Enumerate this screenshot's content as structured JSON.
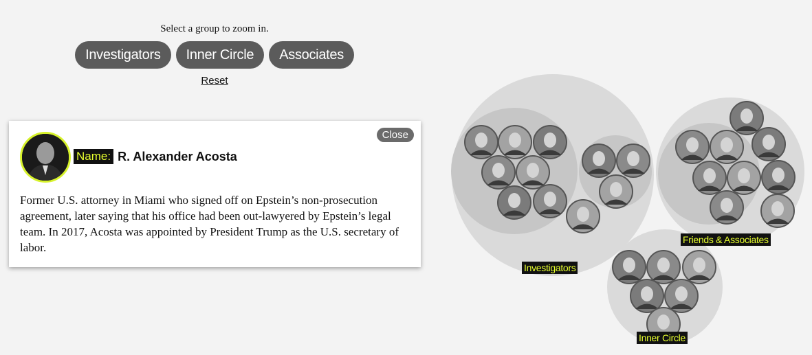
{
  "header": {
    "prompt": "Select a group to zoom in.",
    "buttons": [
      "Investigators",
      "Inner Circle",
      "Associates"
    ],
    "reset_label": "Reset"
  },
  "detail_card": {
    "close_label": "Close",
    "name_label": "Name:",
    "name_value": "R. Alexander Acosta",
    "description": "Former U.S. attorney in Miami who signed off on Epstein’s non-prosecution agreement, later saying that his office had been out-lawyered by Epstein’s legal team. In 2017, Acosta was appointed by President Trump as the U.S. secretary of labor."
  },
  "groups": {
    "investigators": "Investigators",
    "friends": "Friends & Associates",
    "inner": "Inner Circle"
  },
  "colors": {
    "highlight": "#e7ff2e",
    "button_bg": "#5b5b5b",
    "bubble_outer": "#d9d9d9",
    "bubble_inner": "#c6c6c6"
  }
}
